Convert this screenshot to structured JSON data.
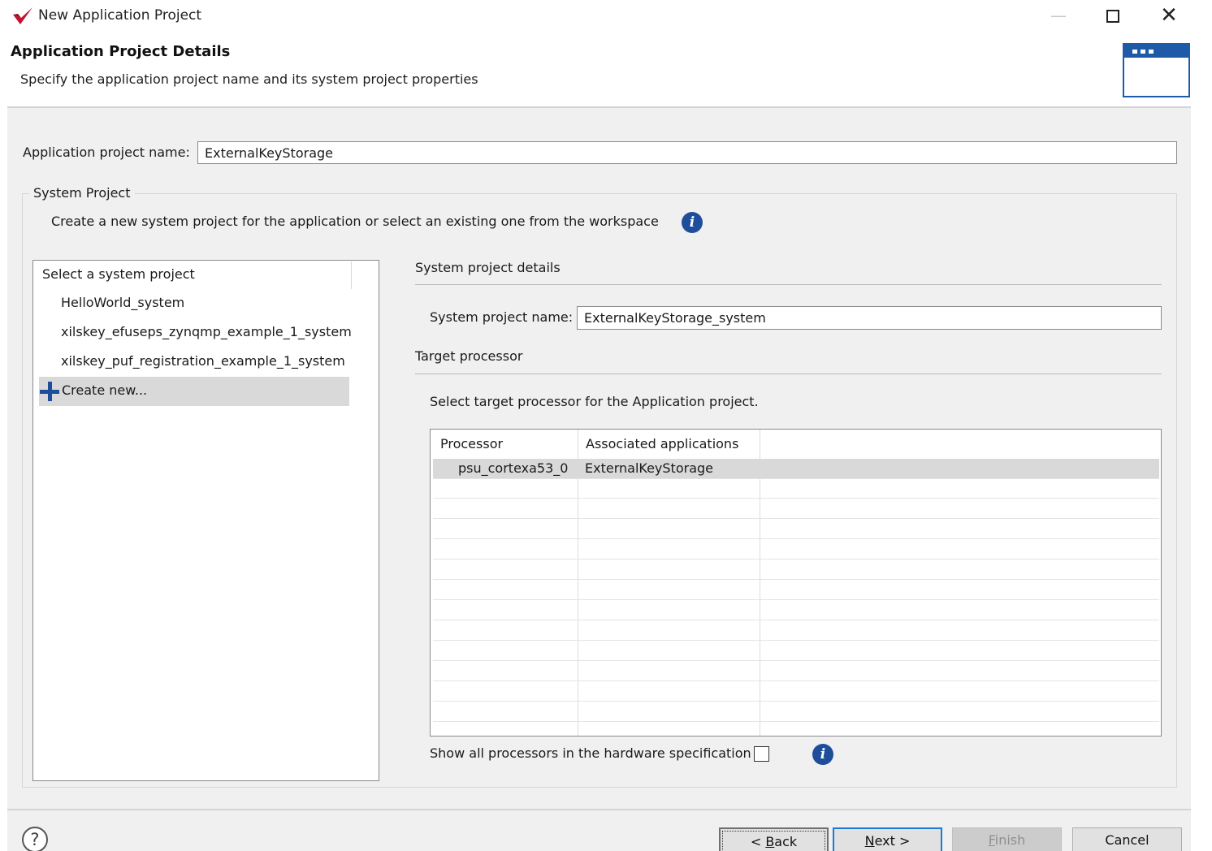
{
  "window": {
    "title": "New Application Project",
    "minimize_glyph": "—",
    "close_glyph": "✕"
  },
  "header": {
    "title": "Application Project Details",
    "subtitle": "Specify the application project name and its system project properties",
    "banner_icon": "window-icon"
  },
  "app_project": {
    "label": "Application project name:",
    "value": "ExternalKeyStorage"
  },
  "system_project": {
    "group_label": "System Project",
    "description": "Create a new system project for the application or select an existing one from the workspace",
    "list": {
      "header": "Select a system project",
      "items": [
        "HelloWorld_system",
        "xilskey_efuseps_zynqmp_example_1_system",
        "xilskey_puf_registration_example_1_system"
      ],
      "create_new": "Create new..."
    },
    "details": {
      "label": "System project details",
      "name_label": "System project name:",
      "name_value": "ExternalKeyStorage_system",
      "target_label": "Target processor",
      "target_desc": "Select target processor for the Application project.",
      "table": {
        "columns": [
          "Processor",
          "Associated applications"
        ],
        "rows": [
          {
            "processor": "psu_cortexa53_0",
            "apps": "ExternalKeyStorage"
          }
        ]
      },
      "show_all_label": "Show all processors in the hardware specification",
      "show_all_checked": false
    }
  },
  "footer": {
    "help_glyph": "?",
    "back": {
      "prefix": "< ",
      "mnemonic": "B",
      "rest": "ack"
    },
    "next": {
      "mnemonic": "N",
      "rest": "ext >"
    },
    "finish": {
      "mnemonic": "F",
      "rest": "inish",
      "enabled": false
    },
    "cancel": "Cancel"
  },
  "colors": {
    "accent": "#1e4e9a",
    "banner": "#1e5aa8",
    "logo_red": "#c8102e",
    "selection": "#d9d9d9",
    "focus_border": "#1c7ad6"
  }
}
